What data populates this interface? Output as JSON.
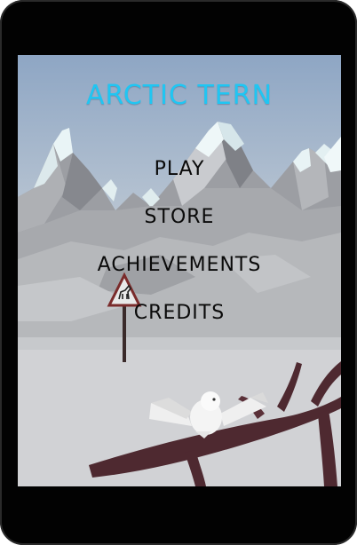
{
  "game": {
    "title": "ARCTIC TERN",
    "menu": [
      {
        "id": "play",
        "label": "PLAY"
      },
      {
        "id": "store",
        "label": "STORE"
      },
      {
        "id": "achievements",
        "label": "ACHIEVEMENTS"
      },
      {
        "id": "credits",
        "label": "CREDITS"
      }
    ]
  },
  "colors": {
    "title": "#1fc6f3",
    "menu_text": "#0a0a0a",
    "device_bezel": "#020202"
  },
  "scene_icons": [
    "mountain-range",
    "deer-crossing-sign",
    "snowy-owl",
    "tree-branch"
  ]
}
